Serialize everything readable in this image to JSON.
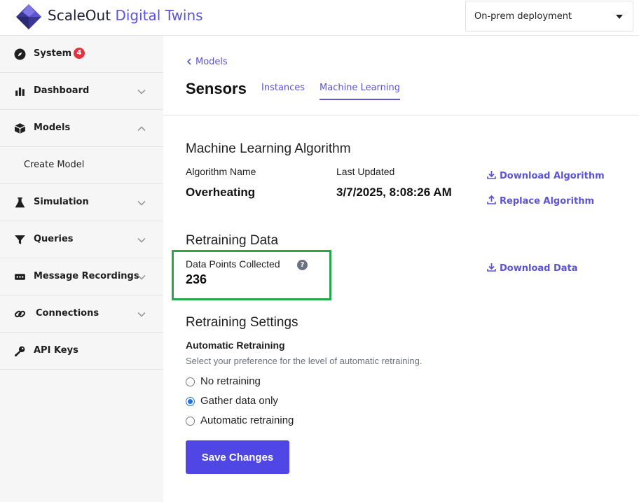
{
  "header": {
    "brand_primary": "ScaleOut",
    "brand_accent": "Digital Twins",
    "deployment_value": "On-prem deployment"
  },
  "sidebar": {
    "items": [
      {
        "label": "System",
        "icon": "compass-icon",
        "badge": "4"
      },
      {
        "label": "Dashboard",
        "icon": "bar-chart-icon",
        "chevron": "down"
      },
      {
        "label": "Models",
        "icon": "cube-icon",
        "chevron": "up",
        "expanded": true
      },
      {
        "label": "Simulation",
        "icon": "flask-icon",
        "chevron": "down"
      },
      {
        "label": "Queries",
        "icon": "filter-icon",
        "chevron": "down"
      },
      {
        "label": "Message Recordings",
        "icon": "recording-icon",
        "chevron": "down"
      },
      {
        "label": "Connections",
        "icon": "link-icon",
        "chevron": "down"
      },
      {
        "label": "API Keys",
        "icon": "key-icon"
      }
    ],
    "sub_items": [
      {
        "label": "Create Model"
      }
    ]
  },
  "main": {
    "back_label": "Models",
    "title": "Sensors",
    "tabs": [
      {
        "label": "Instances",
        "active": false
      },
      {
        "label": "Machine Learning",
        "active": true
      }
    ],
    "ml_algorithm": {
      "heading": "Machine Learning Algorithm",
      "name_label": "Algorithm Name",
      "name_value": "Overheating",
      "updated_label": "Last Updated",
      "updated_value": "3/7/2025, 8:08:26 AM",
      "download_label": "Download Algorithm",
      "replace_label": "Replace Algorithm"
    },
    "retraining_data": {
      "heading": "Retraining Data",
      "points_label": "Data Points Collected",
      "points_value": "236",
      "help_glyph": "?",
      "download_label": "Download Data"
    },
    "retraining_settings": {
      "heading": "Retraining Settings",
      "subheading": "Automatic Retraining",
      "description": "Select your preference for the level of automatic retraining.",
      "options": [
        {
          "label": "No retraining",
          "checked": false
        },
        {
          "label": "Gather data only",
          "checked": true
        },
        {
          "label": "Automatic retraining",
          "checked": false
        }
      ]
    },
    "save_label": "Save Changes"
  },
  "colors": {
    "accent": "#5b54d6",
    "button": "#4f46e5",
    "badge": "#e5323e",
    "highlight": "#27a74a"
  }
}
